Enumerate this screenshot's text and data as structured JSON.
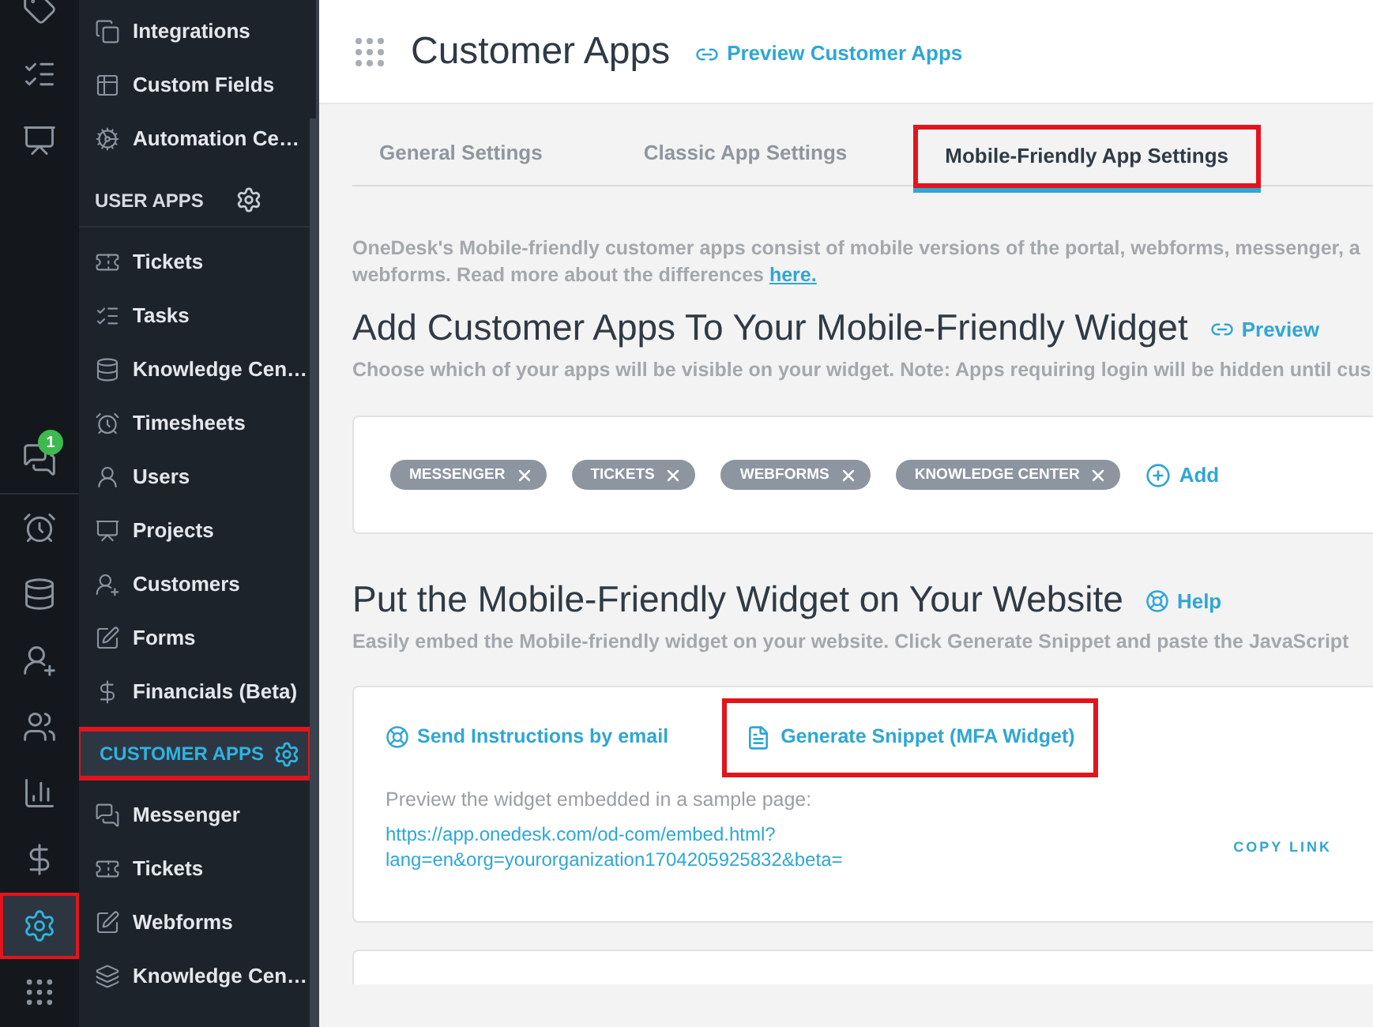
{
  "rail": {
    "items": [
      {
        "selected": false
      },
      {
        "selected": false
      },
      {
        "selected": false
      },
      {
        "selected": false,
        "badge": "1"
      },
      {
        "selected": false
      },
      {
        "selected": false
      },
      {
        "selected": false
      },
      {
        "selected": false
      },
      {
        "selected": false
      },
      {
        "selected": false
      },
      {
        "selected": true
      },
      {
        "selected": false
      }
    ]
  },
  "sidebar": {
    "items": [
      {
        "kind": "link",
        "label": "Integrations"
      },
      {
        "kind": "link",
        "label": "Custom Fields"
      },
      {
        "kind": "link",
        "label": "Automation Ce…"
      },
      {
        "kind": "header",
        "label": "USER APPS",
        "selected": false
      },
      {
        "kind": "link",
        "label": "Tickets"
      },
      {
        "kind": "link",
        "label": "Tasks"
      },
      {
        "kind": "link",
        "label": "Knowledge Cen…"
      },
      {
        "kind": "link",
        "label": "Timesheets"
      },
      {
        "kind": "link",
        "label": "Users"
      },
      {
        "kind": "link",
        "label": "Projects"
      },
      {
        "kind": "link",
        "label": "Customers"
      },
      {
        "kind": "link",
        "label": "Forms"
      },
      {
        "kind": "link",
        "label": "Financials (Beta)"
      },
      {
        "kind": "header",
        "label": "CUSTOMER APPS",
        "selected": true
      },
      {
        "kind": "link",
        "label": "Messenger"
      },
      {
        "kind": "link",
        "label": "Tickets"
      },
      {
        "kind": "link",
        "label": "Webforms"
      },
      {
        "kind": "link",
        "label": "Knowledge Cen…"
      }
    ]
  },
  "header": {
    "title": "Customer Apps",
    "preview_link": "Preview Customer Apps"
  },
  "tabs": [
    {
      "label": "General Settings",
      "selected": false
    },
    {
      "label": "Classic App Settings",
      "selected": false
    },
    {
      "label": "Mobile-Friendly App Settings",
      "selected": true
    }
  ],
  "intro": {
    "line_1": "OneDesk's Mobile-friendly customer apps consist of mobile versions of the portal, webforms, messenger, a",
    "line_2": "webforms. Read more about the differences",
    "link": "here."
  },
  "apps_section": {
    "title": "Add Customer Apps To Your Mobile-Friendly Widget",
    "preview_link": "Preview",
    "description": "Choose which of your apps will be visible on your widget. Note: Apps requiring login will be hidden until cus",
    "tags": [
      "MESSENGER",
      "TICKETS",
      "WEBFORMS",
      "KNOWLEDGE CENTER"
    ],
    "add_button": "Add"
  },
  "embed_section": {
    "title": "Put the Mobile-Friendly Widget on Your Website",
    "help_link": "Help",
    "description": "Easily embed the Mobile-friendly widget on your website. Click Generate Snippet and paste the JavaScript",
    "send_link": "Send Instructions by email",
    "snippet_button": "Generate Snippet (MFA Widget)",
    "preview_label": "Preview the widget embedded in a sample page:",
    "url_lines": [
      "https://app.onedesk.com/od-com/embed.html?",
      "lang=en&org=yourorganization1704205925832&beta="
    ],
    "copy_link": "COPY LINK"
  }
}
